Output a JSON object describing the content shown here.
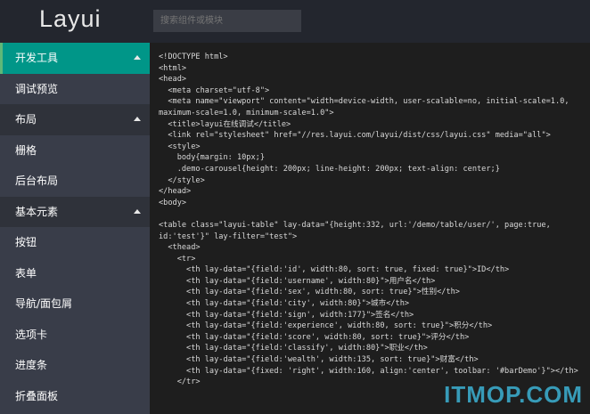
{
  "header": {
    "logo": "Layui",
    "search_placeholder": "搜索组件或模块"
  },
  "sidebar": {
    "items": [
      {
        "label": "开发工具",
        "type": "active",
        "arrow": true
      },
      {
        "label": "调试预览",
        "type": "item"
      },
      {
        "label": "布局",
        "type": "header",
        "arrow": true
      },
      {
        "label": "栅格",
        "type": "item"
      },
      {
        "label": "后台布局",
        "type": "item"
      },
      {
        "label": "基本元素",
        "type": "header",
        "arrow": true
      },
      {
        "label": "按钮",
        "type": "item"
      },
      {
        "label": "表单",
        "type": "item"
      },
      {
        "label": "导航/面包屑",
        "type": "item"
      },
      {
        "label": "选项卡",
        "type": "item"
      },
      {
        "label": "进度条",
        "type": "item"
      },
      {
        "label": "折叠面板",
        "type": "item"
      }
    ]
  },
  "editor": {
    "code": "<!DOCTYPE html>\n<html>\n<head>\n  <meta charset=\"utf-8\">\n  <meta name=\"viewport\" content=\"width=device-width, user-scalable=no, initial-scale=1.0, maximum-scale=1.0, minimum-scale=1.0\">\n  <title>layui在线调试</title>\n  <link rel=\"stylesheet\" href=\"//res.layui.com/layui/dist/css/layui.css\" media=\"all\">\n  <style>\n    body{margin: 10px;}\n    .demo-carousel{height: 200px; line-height: 200px; text-align: center;}\n  </style>\n</head>\n<body>\n\n<table class=\"layui-table\" lay-data=\"{height:332, url:'/demo/table/user/', page:true, id:'test'}\" lay-filter=\"test\">\n  <thead>\n    <tr>\n      <th lay-data=\"{field:'id', width:80, sort: true, fixed: true}\">ID</th>\n      <th lay-data=\"{field:'username', width:80}\">用户名</th>\n      <th lay-data=\"{field:'sex', width:80, sort: true}\">性别</th>\n      <th lay-data=\"{field:'city', width:80}\">城市</th>\n      <th lay-data=\"{field:'sign', width:177}\">签名</th>\n      <th lay-data=\"{field:'experience', width:80, sort: true}\">积分</th>\n      <th lay-data=\"{field:'score', width:80, sort: true}\">评分</th>\n      <th lay-data=\"{field:'classify', width:80}\">职业</th>\n      <th lay-data=\"{field:'wealth', width:135, sort: true}\">财富</th>\n      <th lay-data=\"{fixed: 'right', width:160, align:'center', toolbar: '#barDemo'}\"></th>\n    </tr>"
  },
  "watermark": "ITMOP.COM"
}
